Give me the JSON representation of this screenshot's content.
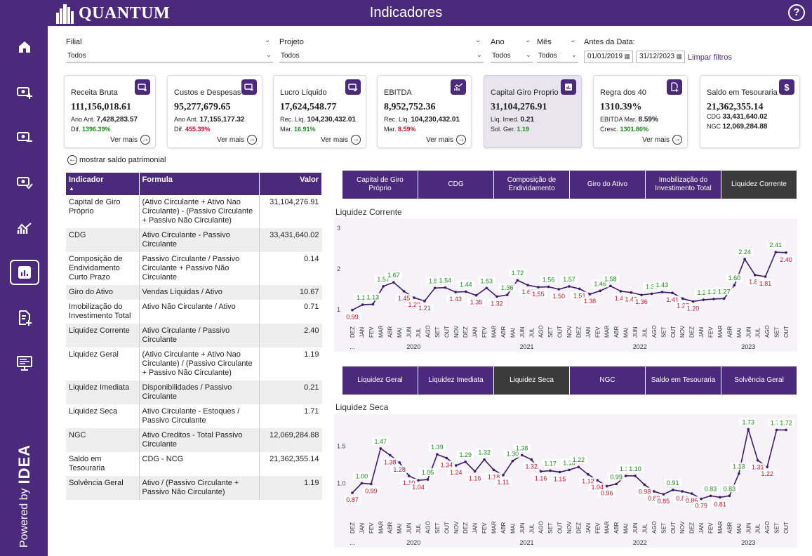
{
  "header": {
    "brand": "QUANTUM",
    "title": "Indicadores",
    "help": "?"
  },
  "sidebar": {
    "powered_by": "Powered by",
    "brand": "IDEA"
  },
  "filters": {
    "filial": {
      "label": "Filial",
      "value": "Todos"
    },
    "projeto": {
      "label": "Projeto",
      "value": "Todos"
    },
    "ano": {
      "label": "Ano",
      "value": "Todos"
    },
    "mes": {
      "label": "Mês",
      "value": "Todos"
    },
    "date": {
      "label": "Antes da Data:",
      "from": "01/01/2019",
      "to": "31/12/2023"
    },
    "clear": "Limpar filtros"
  },
  "cards": [
    {
      "title": "Receita Bruta",
      "value": "111,156,018.61",
      "l1": "Ano Ant.",
      "v1": "7,428,283.57",
      "l2": "Dif.",
      "v2": "1396.39%",
      "v2class": "pos",
      "more": "Ver mais"
    },
    {
      "title": "Custos e Despesas",
      "value": "95,277,679.65",
      "l1": "Ano Ant.",
      "v1": "17,155,177.32",
      "l2": "Dif.",
      "v2": "455.39%",
      "v2class": "neg",
      "more": "Ver mais"
    },
    {
      "title": "Lucro Líquido",
      "value": "17,624,548.77",
      "l1": "Rec. Líq.",
      "v1": "104,230,432.01",
      "l2": "Mar.",
      "v2": "16.91%",
      "v2class": "pos",
      "more": "Ver mais"
    },
    {
      "title": "EBITDA",
      "value": "8,952,752.36",
      "l1": "Rec. Líq.",
      "v1": "104,230,432.01",
      "l2": "Mar.",
      "v2": "8.59%",
      "v2class": "neg",
      "more": "Ver mais"
    },
    {
      "title": "Capital Giro Proprio",
      "value": "31,104,276.91",
      "l1": "Líq. Imed.",
      "v1": "0.21",
      "l2": "Sol. Ger.",
      "v2": "1.19",
      "v2class": "pos",
      "more": ""
    },
    {
      "title": "Regra dos 40",
      "value": "1310.39%",
      "l1": "EBITDA Mar.",
      "v1": "8.59%",
      "l2": "Cresc.",
      "v2": "1301.80%",
      "v2class": "pos",
      "more": "Ver mais"
    },
    {
      "title": "Saldo em Tesouraria",
      "value": "21,362,355.14",
      "l1": "CDG",
      "v1": "33,431,640.02",
      "l2": "NGC",
      "v2": "12,069,284.88",
      "v2class": "",
      "more": ""
    }
  ],
  "toggle_label": "mostrar saldo patrimonial",
  "table": {
    "headers": [
      "Indicador",
      "Formula",
      "Valor"
    ],
    "rows": [
      [
        "Capital de Giro Próprio",
        "(Ativo Circulante + Ativo Nao Circulante) - (Passivo Circulante + Passivo Não Circulante)",
        "31,104,276.91"
      ],
      [
        "CDG",
        "Ativo Circulante - Passivo Circulante",
        "33,431,640.02"
      ],
      [
        "Composição de Endividamento Curto Prazo",
        "Passivo Circulante / Passivo Circulante + Passivo Não Circulante",
        "0.14"
      ],
      [
        "Giro do Ativo",
        "Vendas Líquidas / Ativo",
        "10.67"
      ],
      [
        "Imobilização do Investimento Total",
        "Ativo Não Circulante / Ativo",
        "0.71"
      ],
      [
        "Liquidez Corrente",
        "Ativo Circulante / Passivo Circulante",
        "2.40"
      ],
      [
        "Liquidez Geral",
        "(Ativo Circulante + Ativo Nao Circulante) / (Passivo Circulante + Passivo Não Circulante)",
        "1.19"
      ],
      [
        "Liquidez Imediata",
        "Disponibilidades / Passivo Circulante",
        "0.21"
      ],
      [
        "Liquidez Seca",
        "Ativo Circulante - Estoques / Passivo Circulante",
        "1.71"
      ],
      [
        "NGC",
        "Ativo Creditos - Total Passivo Circulante",
        "12,069,284.88"
      ],
      [
        "Saldo em Tesouraria",
        "CDG - NCG",
        "21,362,355.14"
      ],
      [
        "Solvência Geral",
        "Ativo / (Passivo Circulante + Passivo Não Circulante)",
        "1.19"
      ]
    ]
  },
  "buttons_top": [
    "Capital de Giro Próprio",
    "CDG",
    "Composição de Endividamento",
    "Giro do Ativo",
    "Imobilização do Investimento Total",
    "Liquidez Corrente"
  ],
  "buttons_bottom": [
    "Liquidez Geral",
    "Liquidez Imediata",
    "Liquidez Seca",
    "NGC",
    "Saldo em Tesouraria",
    "Solvência Geral"
  ],
  "colors": {
    "brand": "#4b2a7b",
    "active_tab": "#3b3b3b",
    "line": "#3d1b6b",
    "up": "#1e8a1e",
    "down": "#c8102e"
  },
  "chart_data": [
    {
      "type": "line",
      "title": "Liquidez Corrente",
      "ylim": [
        1,
        3
      ],
      "yticks": [
        "1",
        "2",
        "3"
      ],
      "categories": [
        "DEZ",
        "JAN",
        "FEV",
        "MAR",
        "ABR",
        "MAI",
        "JUN",
        "JUL",
        "AGO",
        "SET",
        "OUT",
        "NOV",
        "DEZ",
        "JAN",
        "FEV",
        "MAR",
        "ABR",
        "MAI",
        "JUN",
        "JUL",
        "AGO",
        "SET",
        "OUT",
        "NOV",
        "DEZ",
        "JAN",
        "FEV",
        "MAR",
        "ABR",
        "MAI",
        "JUN",
        "JUL",
        "AGO",
        "SET",
        "OUT",
        "NOV",
        "DEZ",
        "JAN",
        "FEV",
        "MAR",
        "ABR",
        "MAI",
        "JUN",
        "JUL",
        "AGO",
        "SET",
        "OUT"
      ],
      "year_labels": [
        {
          "label": "...",
          "index": 0
        },
        {
          "label": "2020",
          "index": 6.5
        },
        {
          "label": "2021",
          "index": 18.5
        },
        {
          "label": "2022",
          "index": 30.5
        },
        {
          "label": "2023",
          "index": 42
        }
      ],
      "values": [
        0.99,
        1.12,
        1.13,
        1.57,
        1.67,
        1.45,
        1.29,
        1.21,
        1.53,
        1.54,
        1.43,
        1.44,
        1.35,
        1.53,
        1.32,
        1.36,
        1.72,
        1.6,
        1.55,
        1.56,
        1.5,
        1.57,
        1.51,
        1.38,
        1.46,
        1.58,
        1.45,
        1.42,
        1.36,
        1.39,
        1.43,
        1.41,
        1.27,
        1.2,
        1.24,
        1.26,
        1.27,
        1.6,
        2.24,
        1.85,
        1.81,
        2.41,
        2.4
      ]
    },
    {
      "type": "line",
      "title": "Liquidez Seca",
      "ylim": [
        0.7,
        1.8
      ],
      "yticks": [
        "1.0",
        "1.5"
      ],
      "categories": [
        "DEZ",
        "JAN",
        "FEV",
        "MAR",
        "ABR",
        "MAI",
        "JUN",
        "JUL",
        "AGO",
        "SET",
        "OUT",
        "NOV",
        "DEZ",
        "JAN",
        "FEV",
        "MAR",
        "ABR",
        "MAI",
        "JUN",
        "JUL",
        "AGO",
        "SET",
        "OUT",
        "NOV",
        "DEZ",
        "JAN",
        "FEV",
        "MAR",
        "ABR",
        "MAI",
        "JUN",
        "JUL",
        "AGO",
        "SET",
        "OUT",
        "NOV",
        "DEZ",
        "JAN",
        "FEV",
        "MAR",
        "ABR",
        "MAI",
        "JUN",
        "JUL",
        "AGO",
        "SET",
        "OUT"
      ],
      "year_labels": [
        {
          "label": "...",
          "index": 0
        },
        {
          "label": "2020",
          "index": 6.5
        },
        {
          "label": "2021",
          "index": 18.5
        },
        {
          "label": "2022",
          "index": 30.5
        },
        {
          "label": "2023",
          "index": 42
        }
      ],
      "values": [
        0.87,
        1.0,
        0.99,
        1.47,
        1.38,
        1.28,
        1.1,
        1.04,
        1.05,
        1.39,
        1.34,
        1.24,
        1.29,
        1.16,
        1.32,
        1.18,
        1.11,
        1.3,
        1.38,
        1.32,
        1.16,
        1.17,
        1.15,
        1.18,
        1.22,
        1.12,
        1.04,
        0.96,
        0.99,
        1.1,
        1.1,
        0.98,
        0.89,
        0.85,
        0.91,
        0.89,
        0.86,
        0.79,
        0.83,
        0.81,
        0.83,
        1.13,
        1.73,
        1.31,
        1.22,
        1.72,
        1.72
      ]
    }
  ]
}
